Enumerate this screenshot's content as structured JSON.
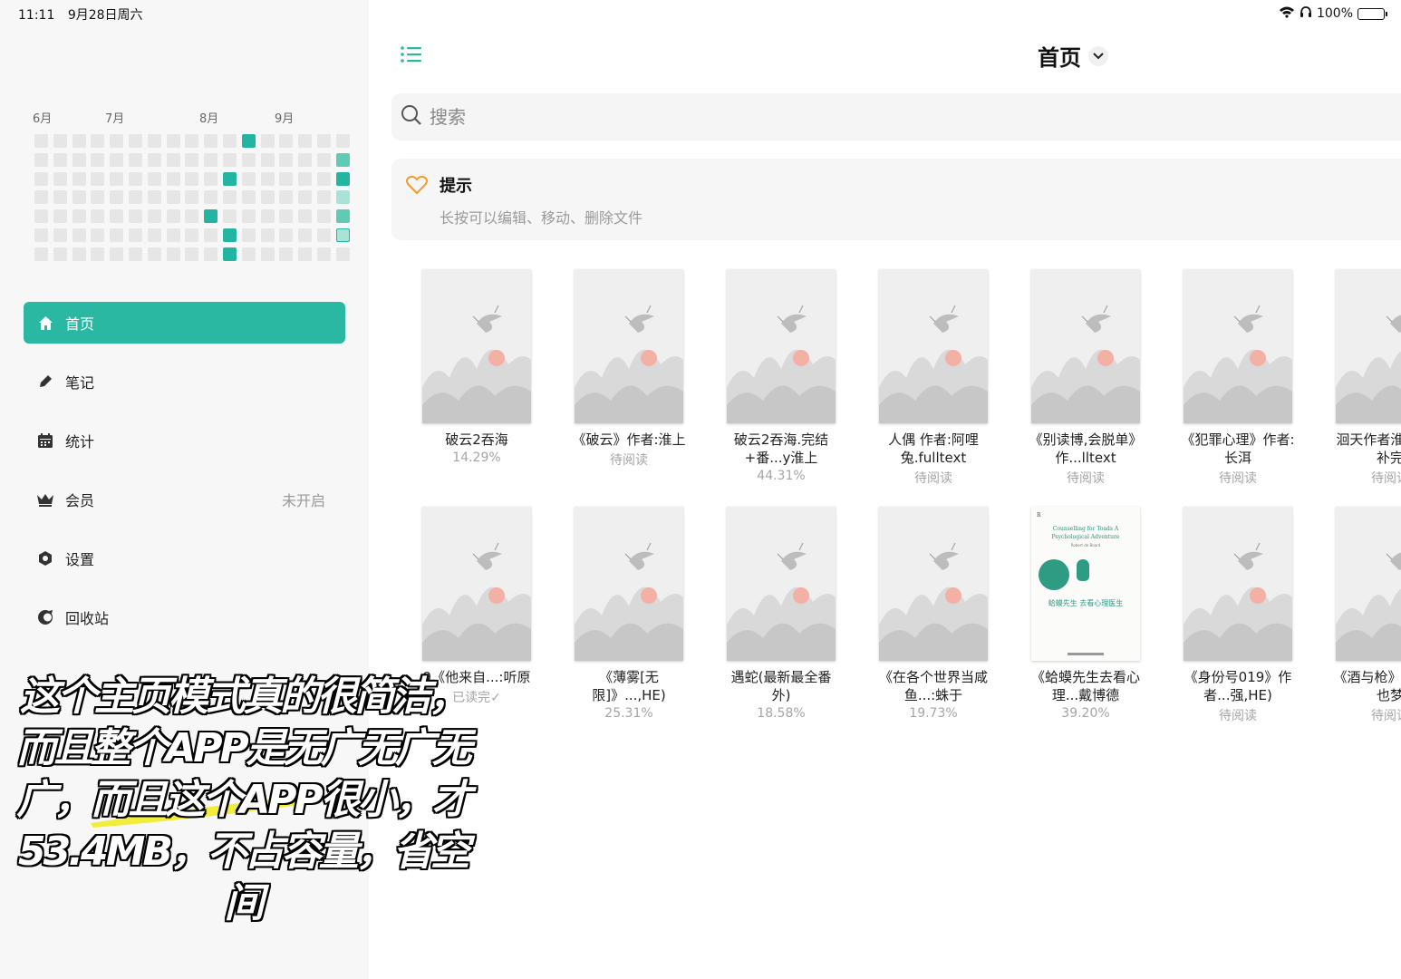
{
  "status_bar": {
    "time": "11:11",
    "date": "9月28日周六",
    "battery": "100%",
    "battery_level": 1.0
  },
  "heatmap": {
    "months": [
      "6月",
      "7月",
      "8月",
      "9月"
    ],
    "colors": {
      "empty": "#e6e6e6",
      "light": "#a9e3d8",
      "mid": "#5fcbb6",
      "dark": "#23b59f"
    }
  },
  "sidebar": {
    "items": [
      {
        "label": "首页",
        "icon": "home-icon",
        "active": true,
        "value": ""
      },
      {
        "label": "笔记",
        "icon": "pen-icon",
        "active": false,
        "value": ""
      },
      {
        "label": "统计",
        "icon": "calendar-icon",
        "active": false,
        "value": ""
      },
      {
        "label": "会员",
        "icon": "crown-icon",
        "active": false,
        "value": "未开启"
      },
      {
        "label": "设置",
        "icon": "gear-icon",
        "active": false,
        "value": ""
      },
      {
        "label": "回收站",
        "icon": "recycle-icon",
        "active": false,
        "value": ""
      }
    ]
  },
  "header": {
    "title": "首页",
    "menu_icon": "list-icon",
    "chevron_icon": "chevron-down-icon"
  },
  "search": {
    "placeholder": "搜索",
    "icon": "search-icon"
  },
  "tip": {
    "title": "提示",
    "text": "长按可以编辑、移动、删除文件",
    "icon": "heart-icon"
  },
  "books": [
    {
      "title": "破云2吞海",
      "progress": "14.29%",
      "cover": "landscape"
    },
    {
      "title": "《破云》作者:淮上",
      "progress": "待阅读",
      "cover": "landscape"
    },
    {
      "title": "破云2吞海.完结+番...y淮上",
      "progress": "44.31%",
      "cover": "landscape"
    },
    {
      "title": "人偶 作者:阿哩兔.fulltext",
      "progress": "待阅读",
      "cover": "landscape"
    },
    {
      "title": "《别读博,会脱单》作...lltext",
      "progress": "待阅读",
      "cover": "landscape"
    },
    {
      "title": "《犯罪心理》作者:长洱",
      "progress": "待阅读",
      "cover": "landscape"
    },
    {
      "title": "洄天作者淮完结...补完",
      "progress": "待阅读",
      "cover": "landscape"
    },
    {
      "title": "9《他来自...:听原",
      "progress": "已读完✓",
      "cover": "landscape"
    },
    {
      "title": "《薄雾[无限]》...,HE)",
      "progress": "25.31%",
      "cover": "landscape"
    },
    {
      "title": "遇蛇(最新最全番外)",
      "progress": "18.58%",
      "cover": "landscape"
    },
    {
      "title": "《在各个世界当咸鱼...:蛛于",
      "progress": "19.73%",
      "cover": "landscape"
    },
    {
      "title": "《蛤蟆先生去看心理...戴博德",
      "progress": "39.20%",
      "cover": "green",
      "cover_text": {
        "publisher": "R",
        "title_en": "Counselling for Toads A Psychological Adventure",
        "author_en": "Robert de Board",
        "title_cn": "蛤蟆先生 去看心理医生"
      }
    },
    {
      "title": "《身份号019》作者...强,HE)",
      "progress": "待阅读",
      "cover": "landscape"
    },
    {
      "title": "《酒与枪》作者:梦也梦",
      "progress": "待阅读",
      "cover": "landscape"
    }
  ],
  "caption": {
    "text": "这个主页模式真的很简洁，而且整个APP是无广无广无广，而且这个APP很小，才53.4MB，不占容量，省空间"
  },
  "accent_color": "#2bb8a3"
}
